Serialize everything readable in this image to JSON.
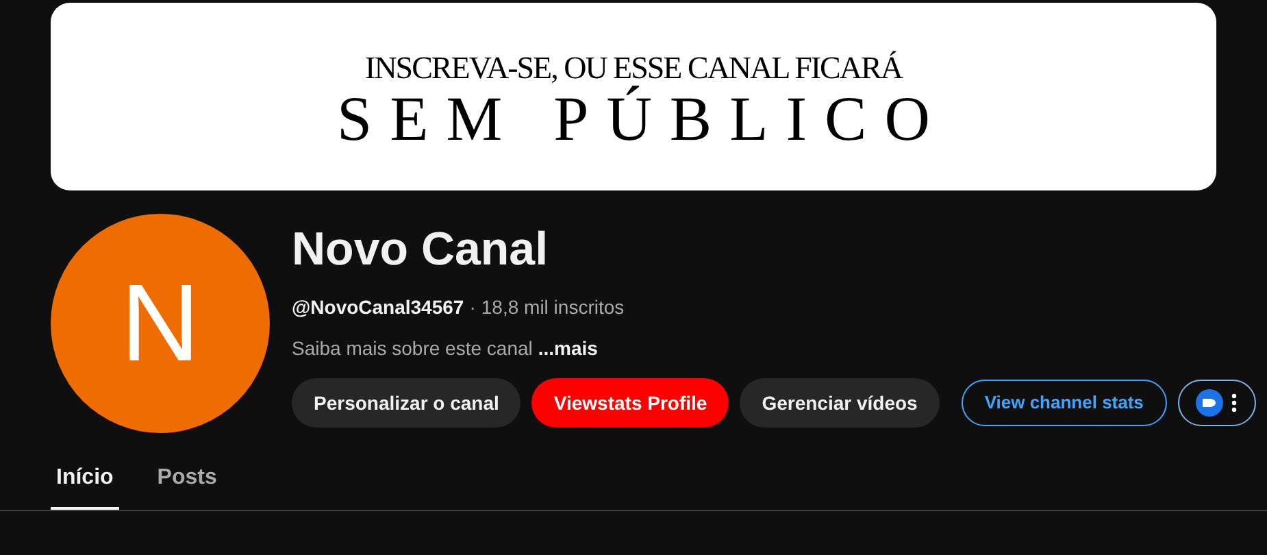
{
  "banner": {
    "line_1": "INSCREVA-SE, OU ESSE CANAL FICARÁ",
    "line_2": "SEM PÚBLICO"
  },
  "channel": {
    "avatar_letter": "N",
    "name": "Novo Canal",
    "handle": "@NovoCanal34567",
    "separator": "·",
    "subscribers": "18,8 mil inscritos",
    "description": "Saiba mais sobre este canal",
    "more": "...mais"
  },
  "buttons": [
    {
      "label": "Personalizar o canal",
      "kind": "neutral"
    },
    {
      "label": "Viewstats Profile",
      "kind": "red"
    },
    {
      "label": "Gerenciar vídeos",
      "kind": "neutral"
    },
    {
      "label": "View channel stats",
      "kind": "outline"
    },
    {
      "kind": "extension"
    }
  ],
  "tabs": [
    {
      "label": "Início",
      "selected": true
    },
    {
      "label": "Posts",
      "selected": false
    }
  ]
}
